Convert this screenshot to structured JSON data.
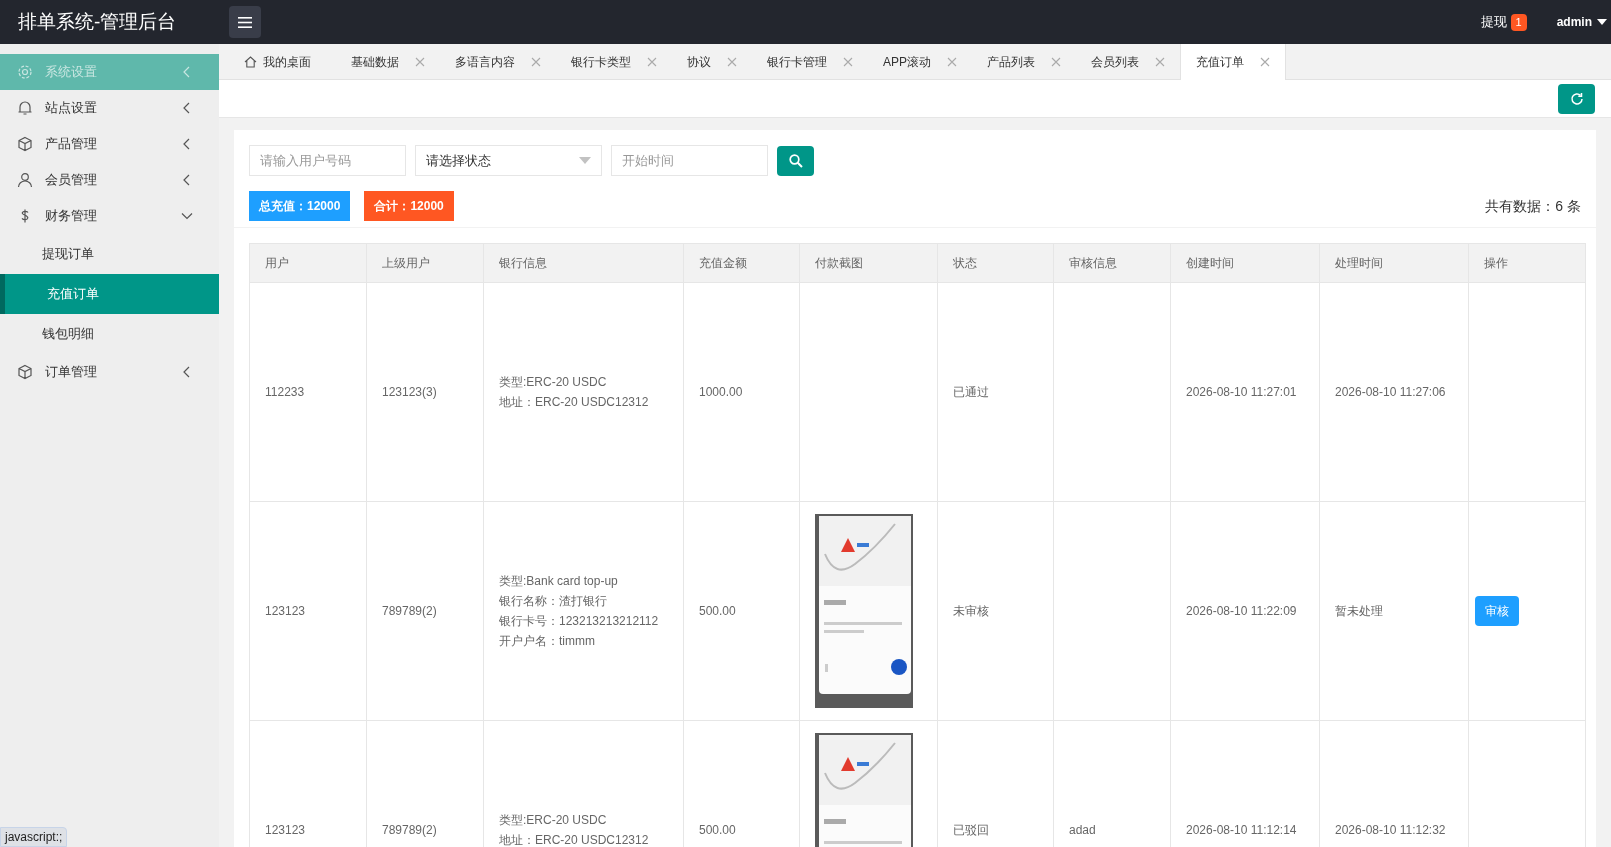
{
  "header": {
    "title": "排单系统-管理后台",
    "withdraw": {
      "label": "提现",
      "badge": "1"
    },
    "user": "admin"
  },
  "sidebar": {
    "items": [
      {
        "label": "系统设置",
        "kind": "gear",
        "selected": true,
        "expanded": false
      },
      {
        "label": "站点设置",
        "kind": "bell",
        "selected": false,
        "expanded": false
      },
      {
        "label": "产品管理",
        "kind": "box",
        "selected": false,
        "expanded": false
      },
      {
        "label": "会员管理",
        "kind": "user",
        "selected": false,
        "expanded": false
      },
      {
        "label": "财务管理",
        "kind": "dollar",
        "selected": false,
        "expanded": true,
        "children": [
          {
            "label": "提现订单",
            "selected": false
          },
          {
            "label": "充值订单",
            "selected": true
          },
          {
            "label": "钱包明细",
            "selected": false
          }
        ]
      },
      {
        "label": "订单管理",
        "kind": "box",
        "selected": false,
        "expanded": false
      }
    ]
  },
  "tabs": [
    {
      "label": "我的桌面",
      "kind": "home",
      "selected": false
    },
    {
      "label": "基础数据",
      "kind": "closable",
      "selected": false
    },
    {
      "label": "多语言内容",
      "kind": "closable",
      "selected": false
    },
    {
      "label": "银行卡类型",
      "kind": "closable",
      "selected": false
    },
    {
      "label": "协议",
      "kind": "closable",
      "selected": false
    },
    {
      "label": "银行卡管理",
      "kind": "closable",
      "selected": false
    },
    {
      "label": "APP滚动",
      "kind": "closable",
      "selected": false
    },
    {
      "label": "产品列表",
      "kind": "closable",
      "selected": false
    },
    {
      "label": "会员列表",
      "kind": "closable",
      "selected": false
    },
    {
      "label": "充值订单",
      "kind": "closable",
      "selected": true
    }
  ],
  "filters": {
    "user_placeholder": "请输入用户号码",
    "status_select": "请选择状态",
    "start_placeholder": "开始时间"
  },
  "summary": {
    "total": "总充值：12000",
    "sum": "合计：12000",
    "count": "共有数据：6 条"
  },
  "table": {
    "columns": [
      "用户",
      "上级用户",
      "银行信息",
      "充值金额",
      "付款截图",
      "状态",
      "审核信息",
      "创建时间",
      "处理时间",
      "操作"
    ],
    "rows": [
      {
        "user": "112233",
        "parent": "123123(3)",
        "bank_info": [
          "类型:ERC-20 USDC",
          "地址：ERC-20 USDC12312"
        ],
        "amount": "1000.00",
        "screenshot": false,
        "status": "已通过",
        "created": "2026-08-10 11:27:01",
        "processed": "2026-08-10 11:27:06"
      },
      {
        "user": "123123",
        "parent": "789789(2)",
        "bank_info": [
          "类型:Bank card top-up",
          "银行名称：渣打银行",
          "银行卡号：123213213212112",
          "开户户名：timmm"
        ],
        "amount": "500.00",
        "screenshot": true,
        "status": "未审核",
        "created": "2026-08-10 11:22:09",
        "processed": "暂未处理",
        "action": "审核"
      },
      {
        "user": "123123",
        "parent": "789789(2)",
        "bank_info": [
          "类型:ERC-20 USDC",
          "地址：ERC-20 USDC12312"
        ],
        "amount": "500.00",
        "screenshot": true,
        "status": "已驳回",
        "review": "adad",
        "created": "2026-08-10 11:12:14",
        "processed": "2026-08-10 11:12:32"
      }
    ]
  },
  "status_bar": "javascript:;"
}
